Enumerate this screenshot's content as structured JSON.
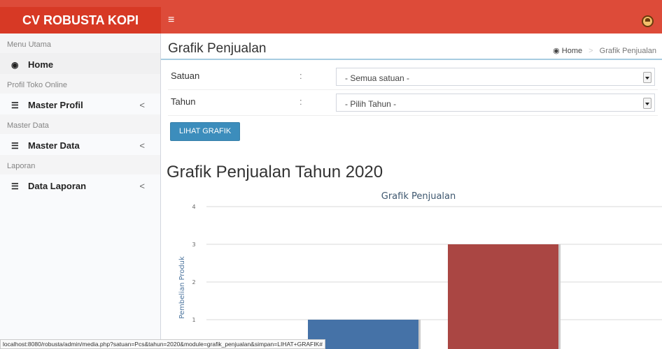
{
  "app": {
    "brand": "CV ROBUSTA KOPI",
    "toggle_icon": "≡"
  },
  "sidebar": {
    "items": [
      {
        "type": "header",
        "label": "Menu Utama"
      },
      {
        "type": "link",
        "label": "Home",
        "icon": "dashboard-icon",
        "active": true
      },
      {
        "type": "header",
        "label": "Profil Toko Online"
      },
      {
        "type": "link",
        "label": "Master Profil",
        "icon": "database-icon",
        "chevron": "<"
      },
      {
        "type": "header",
        "label": "Master Data"
      },
      {
        "type": "link",
        "label": "Master Data",
        "icon": "database-icon",
        "chevron": "<"
      },
      {
        "type": "header",
        "label": "Laporan"
      },
      {
        "type": "link",
        "label": "Data Laporan",
        "icon": "database-icon",
        "chevron": "<"
      }
    ]
  },
  "page": {
    "title": "Grafik Penjualan",
    "breadcrumb": {
      "home": "Home",
      "separator": ">",
      "current": "Grafik Penjualan"
    }
  },
  "form": {
    "satuan": {
      "label": "Satuan",
      "colon": ":",
      "value": "- Semua satuan -"
    },
    "tahun": {
      "label": "Tahun",
      "colon": ":",
      "value": "- Pilih Tahun -"
    },
    "button": "LIHAT GRAFIK"
  },
  "chart_heading": "Grafik Penjualan Tahun 2020",
  "chart_data": {
    "type": "bar",
    "title": "Grafik Penjualan",
    "ylabel": "Pembelian Produk",
    "ylim": [
      0,
      4
    ],
    "yticks": [
      1,
      2,
      3,
      4
    ],
    "grid": true,
    "values": [
      1,
      3
    ],
    "colors": [
      "#4572a7",
      "#aa4643"
    ]
  },
  "status_url": "localhost:8080/robusta/admin/media.php?satuan=Pcs&tahun=2020&module=grafik_penjualan&simpan=LIHAT+GRAFIK#"
}
